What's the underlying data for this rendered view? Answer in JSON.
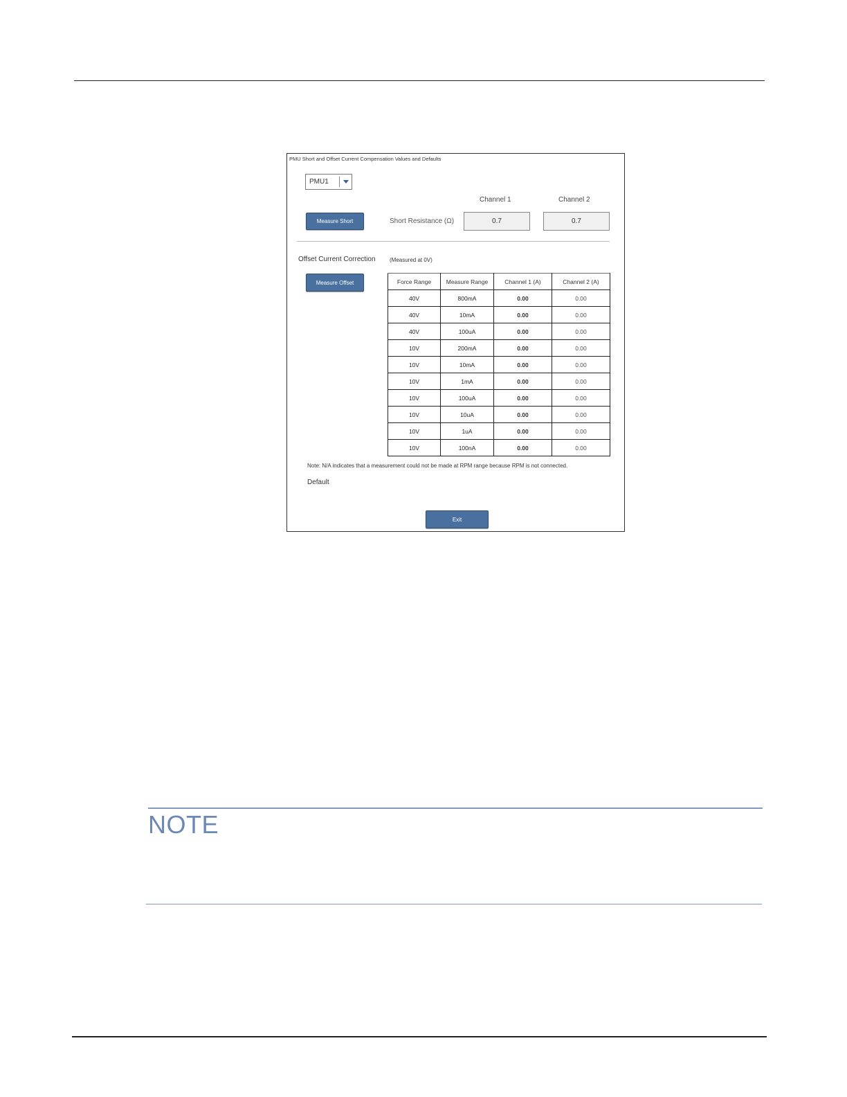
{
  "dialog": {
    "title": "PMU Short and Offset Current Compensation Values and Defaults",
    "pmu_select": {
      "value": "PMU1"
    },
    "channel_headers": [
      "Channel 1",
      "Channel 2"
    ],
    "measure_short_label": "Measure Short",
    "short_resistance_label": "Short Resistance (Ω)",
    "short_resistance_values": [
      "0.7",
      "0.7"
    ],
    "offset_label": "Offset Current Correction",
    "measured_note": "(Measured at 0V)",
    "measure_offset_label": "Measure Offset",
    "table": {
      "headers": [
        "Force Range",
        "Measure Range",
        "Channel 1 (A)",
        "Channel 2 (A)"
      ],
      "rows": [
        [
          "40V",
          "800mA",
          "0.00",
          "0.00"
        ],
        [
          "40V",
          "10mA",
          "0.00",
          "0.00"
        ],
        [
          "40V",
          "100uA",
          "0.00",
          "0.00"
        ],
        [
          "10V",
          "200mA",
          "0.00",
          "0.00"
        ],
        [
          "10V",
          "10mA",
          "0.00",
          "0.00"
        ],
        [
          "10V",
          "1mA",
          "0.00",
          "0.00"
        ],
        [
          "10V",
          "100uA",
          "0.00",
          "0.00"
        ],
        [
          "10V",
          "10uA",
          "0.00",
          "0.00"
        ],
        [
          "10V",
          "1uA",
          "0.00",
          "0.00"
        ],
        [
          "10V",
          "100nA",
          "0.00",
          "0.00"
        ]
      ]
    },
    "na_note": "Note: N/A indicates that a measurement could not be made at RPM range because RPM is not connected.",
    "default_label": "Default",
    "exit_label": "Exit"
  },
  "note": {
    "title": "NOTE"
  },
  "colors": {
    "button": "#49709f",
    "note_accent": "#6b87b5"
  }
}
